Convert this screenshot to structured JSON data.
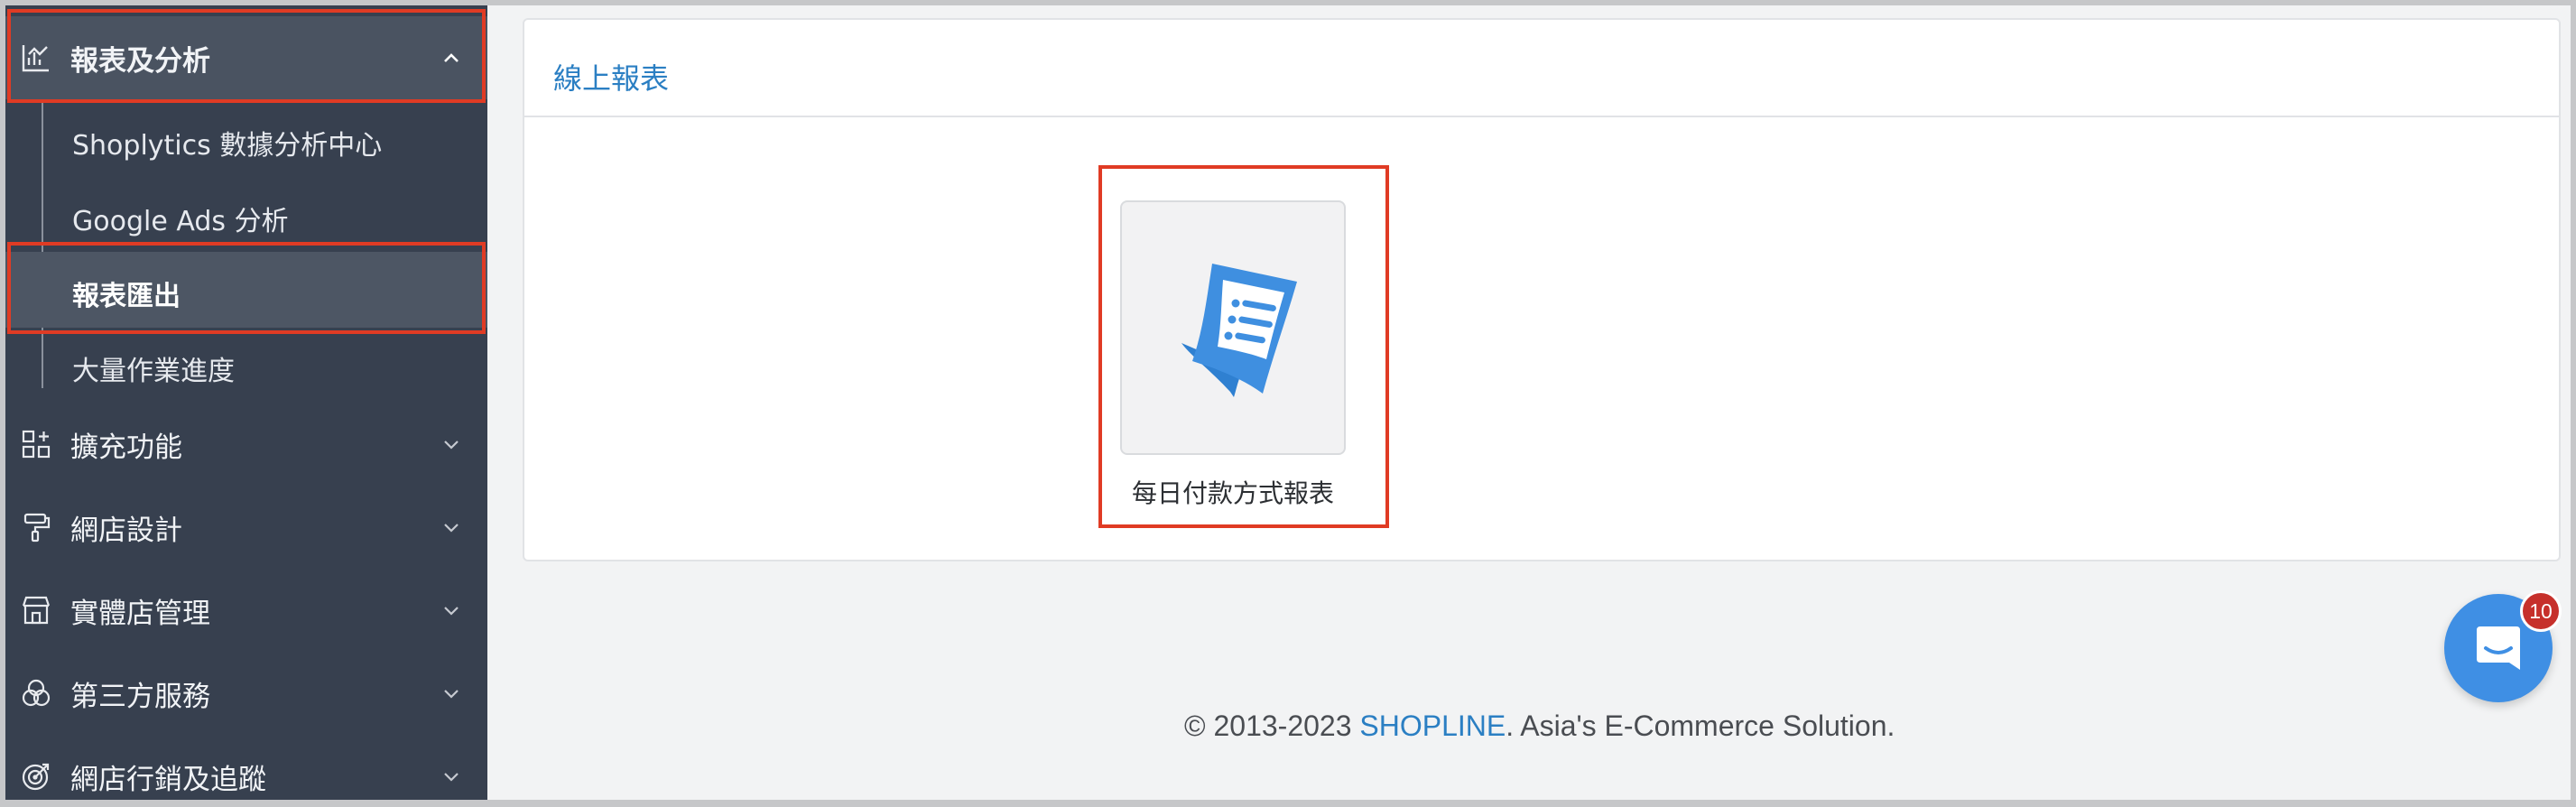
{
  "sidebar": {
    "reports_section": {
      "label": "報表及分析",
      "expanded": true
    },
    "sub_items": [
      {
        "label": "Shoplytics 數據分析中心"
      },
      {
        "label": "Google Ads 分析"
      },
      {
        "label": "報表匯出",
        "active": true
      },
      {
        "label": "大量作業進度"
      }
    ],
    "sections": [
      {
        "label": "擴充功能",
        "icon": "grid-plus-icon"
      },
      {
        "label": "網店設計",
        "icon": "paint-roller-icon"
      },
      {
        "label": "實體店管理",
        "icon": "store-icon"
      },
      {
        "label": "第三方服務",
        "icon": "rings-icon"
      },
      {
        "label": "網店行銷及追蹤",
        "icon": "target-icon"
      }
    ]
  },
  "main": {
    "card_title": "線上報表",
    "reports": [
      {
        "label": "每日付款方式報表",
        "icon": "receipt-icon"
      }
    ]
  },
  "footer": {
    "prefix": "© 2013-2023 ",
    "brand": "SHOPLINE",
    "suffix": ". Asia's E-Commerce Solution."
  },
  "chat": {
    "badge_count": "10"
  },
  "colors": {
    "accent": "#2b7fc3",
    "sidebar_bg": "#37404f",
    "highlight": "#e03b24",
    "badge": "#c6302b"
  }
}
